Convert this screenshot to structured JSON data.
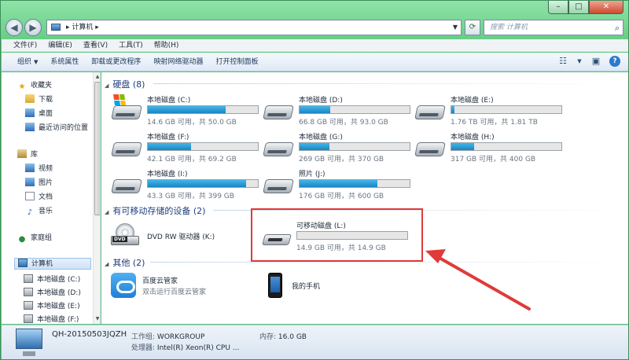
{
  "address": {
    "crumb_arrow": "▸",
    "location": "计算机",
    "tail_arrow": "▸"
  },
  "search": {
    "placeholder": "搜索 计算机"
  },
  "menu": [
    "文件(F)",
    "编辑(E)",
    "查看(V)",
    "工具(T)",
    "帮助(H)"
  ],
  "toolbar": {
    "organize": "组织",
    "items": [
      "系统属性",
      "卸载或更改程序",
      "映射网络驱动器",
      "打开控制面板"
    ]
  },
  "nav": {
    "favorites": "收藏夹",
    "downloads": "下载",
    "desktop": "桌面",
    "recent": "最近访问的位置",
    "libraries": "库",
    "videos": "视频",
    "pictures": "图片",
    "documents": "文档",
    "music": "音乐",
    "homegroup": "家庭组",
    "computer": "计算机",
    "drives": [
      "本地磁盘 (C:)",
      "本地磁盘 (D:)",
      "本地磁盘 (E:)",
      "本地磁盘 (F:)"
    ]
  },
  "groups": {
    "hdd": "硬盘 (8)",
    "removable": "有可移动存储的设备 (2)",
    "other": "其他 (2)"
  },
  "drives": [
    {
      "name": "本地磁盘 (C:)",
      "info": "14.6 GB 可用，共 50.0 GB",
      "used": 0.71
    },
    {
      "name": "本地磁盘 (D:)",
      "info": "66.8 GB 可用，共 93.0 GB",
      "used": 0.28
    },
    {
      "name": "本地磁盘 (E:)",
      "info": "1.76 TB 可用，共 1.81 TB",
      "used": 0.03
    },
    {
      "name": "本地磁盘 (F:)",
      "info": "42.1 GB 可用，共 69.2 GB",
      "used": 0.39
    },
    {
      "name": "本地磁盘 (G:)",
      "info": "269 GB 可用，共 370 GB",
      "used": 0.27
    },
    {
      "name": "本地磁盘 (H:)",
      "info": "317 GB 可用，共 400 GB",
      "used": 0.21
    },
    {
      "name": "本地磁盘 (I:)",
      "info": "43.3 GB 可用，共 399 GB",
      "used": 0.89
    },
    {
      "name": "照片 (J:)",
      "info": "176 GB 可用，共 600 GB",
      "used": 0.71
    }
  ],
  "removable": {
    "dvd": {
      "name": "DVD RW 驱动器 (K:)",
      "badge": "DVD"
    },
    "usb": {
      "name": "可移动磁盘 (L:)",
      "info": "14.9 GB 可用，共 14.9 GB",
      "used": 0.0
    }
  },
  "other": [
    {
      "name": "百度云管家",
      "sub": "双击运行百度云管家"
    },
    {
      "name": "我的手机",
      "sub": ""
    }
  ],
  "status": {
    "computer_name": "QH-20150503JQZH",
    "workgroup_label": "工作组:",
    "workgroup": "WORKGROUP",
    "memory_label": "内存:",
    "memory": "16.0 GB",
    "cpu_label": "处理器:",
    "cpu": "Intel(R) Xeon(R) CPU ..."
  },
  "colors": {
    "annotation": "#e03a3a",
    "usage_bar": "#1a85c4"
  }
}
